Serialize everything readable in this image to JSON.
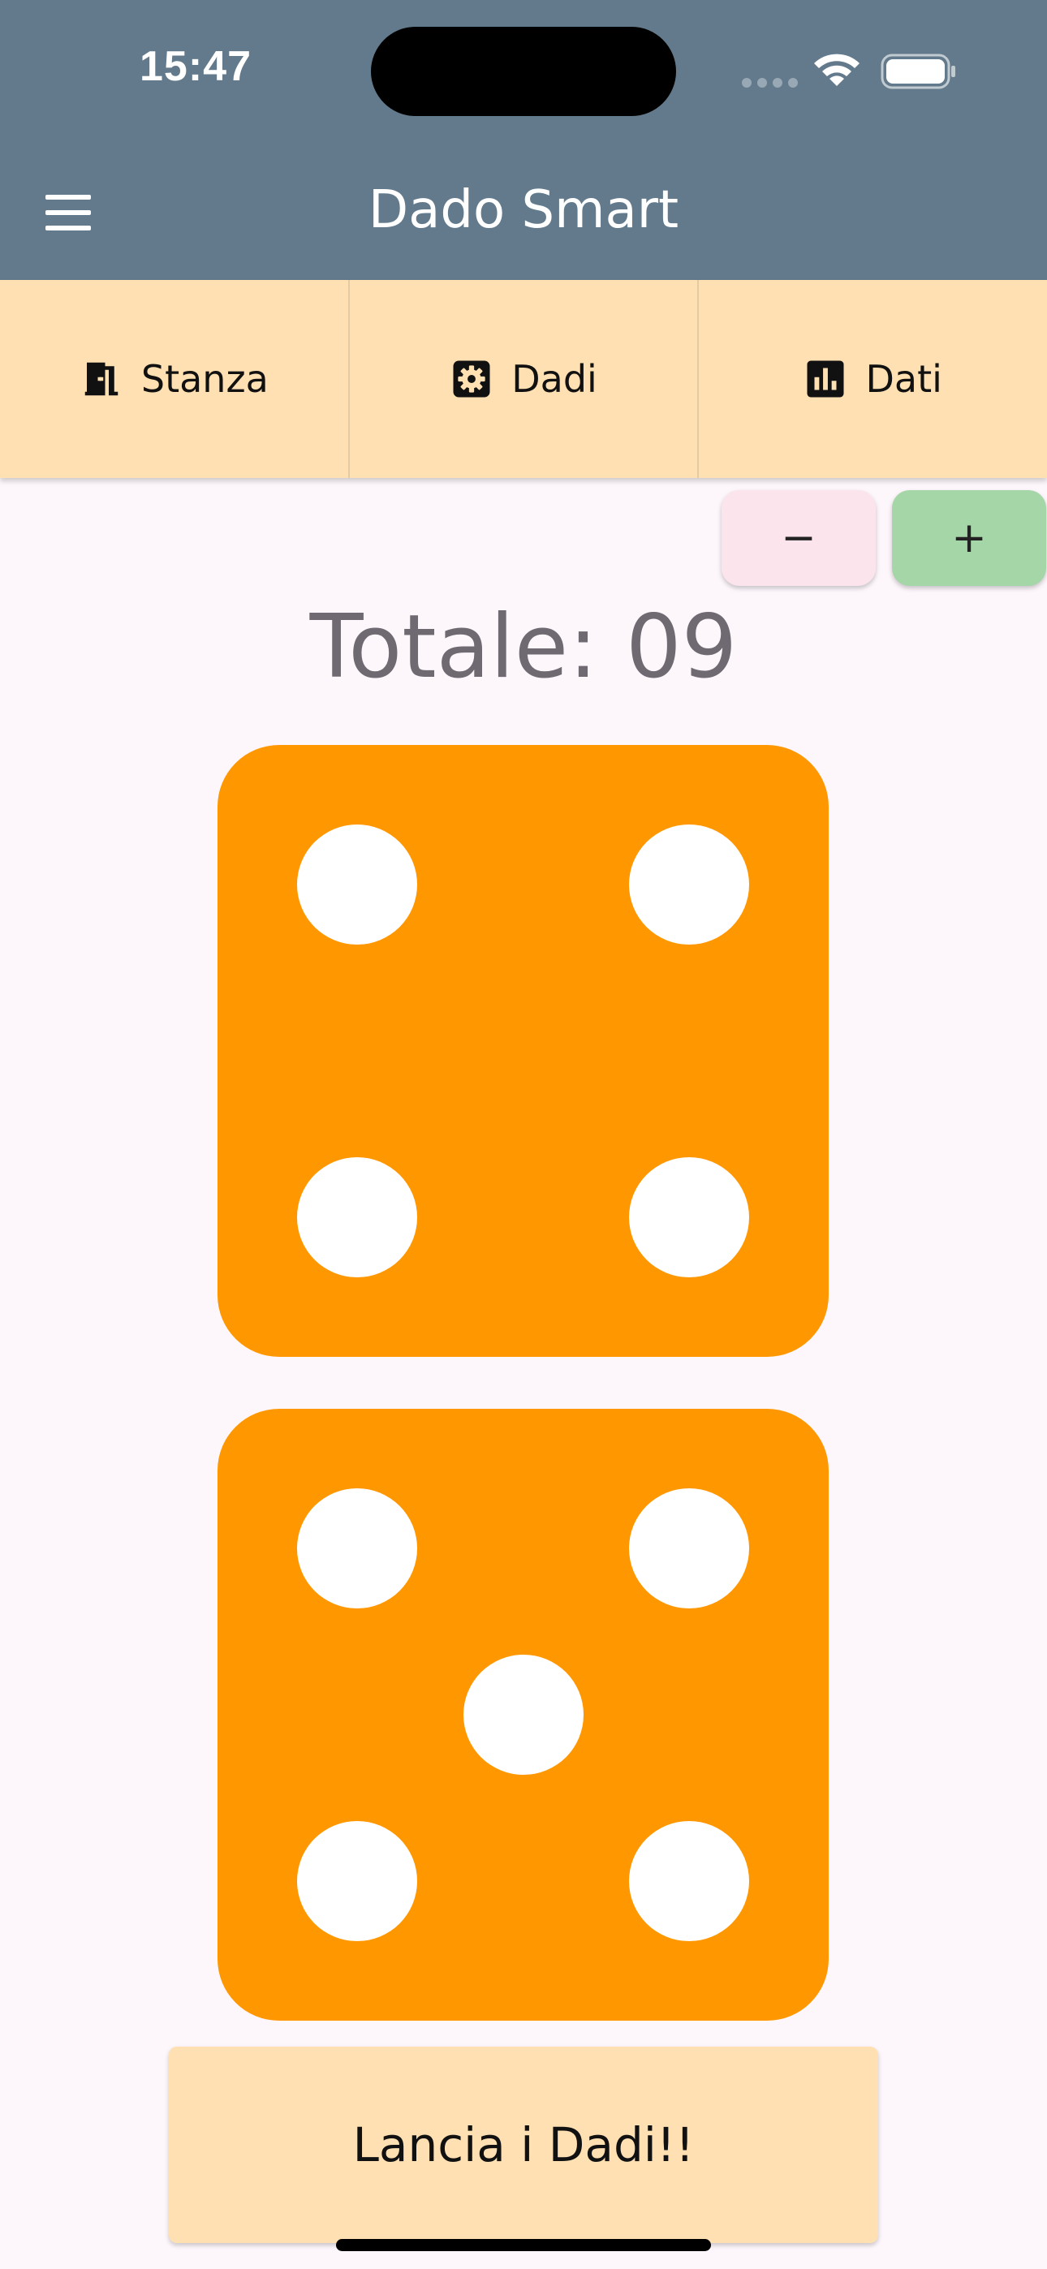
{
  "status_bar": {
    "time": "15:47"
  },
  "app_bar": {
    "title": "Dado Smart",
    "menu_icon": "hamburger-menu-icon",
    "background_color": "#627A8C"
  },
  "tabs": [
    {
      "label": "Stanza",
      "icon": "door-icon"
    },
    {
      "label": "Dadi",
      "icon": "gear-icon"
    },
    {
      "label": "Dati",
      "icon": "bar-chart-icon"
    }
  ],
  "stepper": {
    "minus_label": "−",
    "plus_label": "+"
  },
  "total": {
    "text": "Totale: 09"
  },
  "dice": [
    {
      "value": 4,
      "color": "#FF9800"
    },
    {
      "value": 5,
      "color": "#FF9800"
    }
  ],
  "roll_button": {
    "label": "Lancia i Dadi!!"
  },
  "colors": {
    "tab_background": "#FFE0B2",
    "page_background": "#FDF7FC",
    "minus_button": "#FCE4EC",
    "plus_button": "#A5D6A7"
  }
}
